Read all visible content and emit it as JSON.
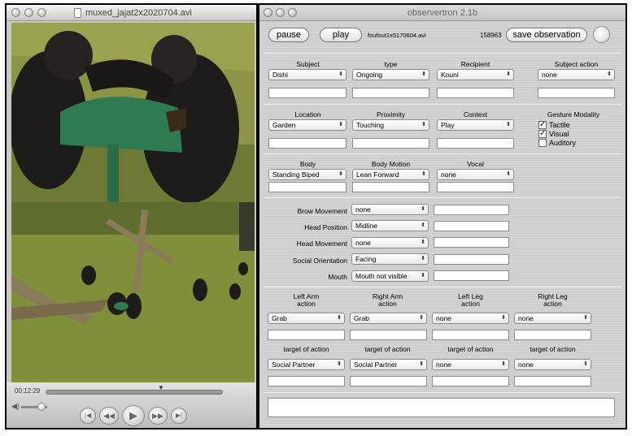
{
  "player": {
    "title": "muxed_jajat2x2020704.avi",
    "time": "00:12:29"
  },
  "app": {
    "title": "observertron 2.1b",
    "pause": "pause",
    "play": "play",
    "filename": "foufout1x5170604.avi",
    "frame": "158963",
    "save": "save observation"
  },
  "section1": {
    "labels": [
      "Subject",
      "type",
      "Recipient",
      "Subject action"
    ],
    "values": [
      "Dishi",
      "Ongoing",
      "Kouni",
      "none"
    ]
  },
  "section2": {
    "labels": [
      "Location",
      "Proximity",
      "Context"
    ],
    "values": [
      "Garden",
      "Touching",
      "Play"
    ],
    "gesture": {
      "title": "Gesture Modality",
      "options": [
        {
          "label": "Tactile",
          "checked": "✓"
        },
        {
          "label": "Visual",
          "checked": "✓"
        },
        {
          "label": "Auditory",
          "checked": ""
        }
      ]
    }
  },
  "section3": {
    "labels": [
      "Body",
      "Body Motion",
      "Vocal"
    ],
    "values": [
      "Standing Biped",
      "Lean Forward",
      "none"
    ]
  },
  "section4": {
    "rows": [
      {
        "label": "Brow Movement",
        "value": "none"
      },
      {
        "label": "Head Position",
        "value": "Midline"
      },
      {
        "label": "Head Movement",
        "value": "none"
      },
      {
        "label": "Social Orientation",
        "value": "Facing"
      },
      {
        "label": "Mouth",
        "value": "Mouth not visible"
      }
    ]
  },
  "section5": {
    "labels": [
      "Left Arm\naction",
      "Right Arm\naction",
      "Left Leg\naction",
      "Right Leg\naction"
    ],
    "values": [
      "Grab",
      "Grab",
      "none",
      "none"
    ],
    "target_labels": [
      "target of action",
      "target of action",
      "target of action",
      "target of action"
    ],
    "target_values": [
      "Social Partner",
      "Social Partner",
      "none",
      "none"
    ]
  },
  "colors": {
    "grass": "#7f8f3a",
    "gorilla": "#1e1c1b",
    "sign": "#2f7a52"
  }
}
